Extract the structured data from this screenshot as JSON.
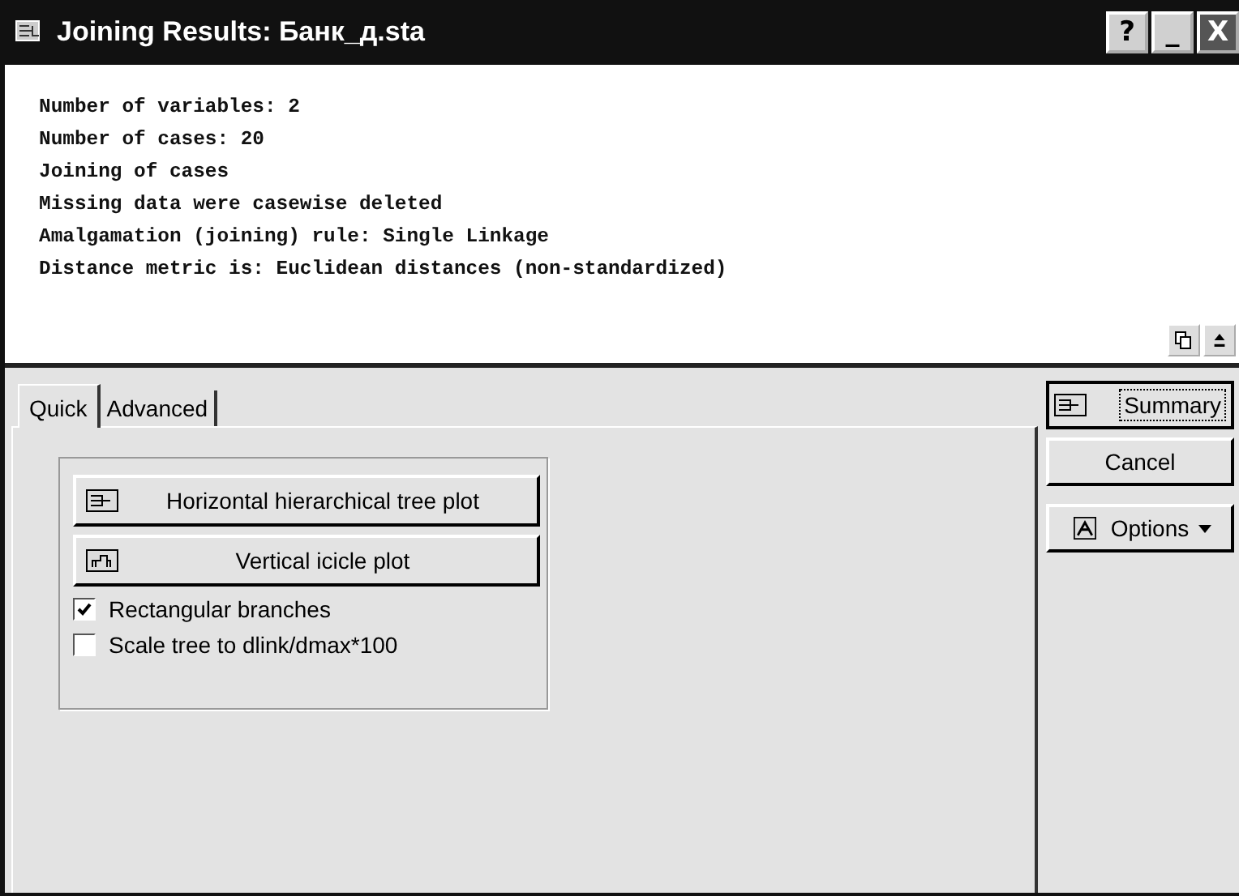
{
  "window": {
    "title": "Joining Results: Банк_д.sta",
    "controls": [
      "?",
      "_",
      "X"
    ]
  },
  "results": [
    "Number of variables: 2",
    "Number of cases: 20",
    "Joining of cases",
    "Missing data were casewise deleted",
    "Amalgamation (joining) rule: Single Linkage",
    "Distance metric is: Euclidean distances (non-standardized)"
  ],
  "tabs": [
    {
      "label": "Quick",
      "selected": true
    },
    {
      "label": "Advanced",
      "selected": false
    }
  ],
  "plot_buttons": [
    {
      "label": "Horizontal hierarchical tree plot",
      "kind": "horizontal"
    },
    {
      "label": "Vertical icicle plot",
      "kind": "vertical"
    }
  ],
  "checkboxes": [
    {
      "label": "Rectangular branches",
      "checked": true
    },
    {
      "label": "Scale tree to dlink/dmax*100",
      "checked": false
    }
  ],
  "side_buttons": [
    {
      "label": "Summary",
      "kind": "summary"
    },
    {
      "label": "Cancel",
      "kind": "plain"
    },
    {
      "label": "Options",
      "kind": "options"
    }
  ]
}
